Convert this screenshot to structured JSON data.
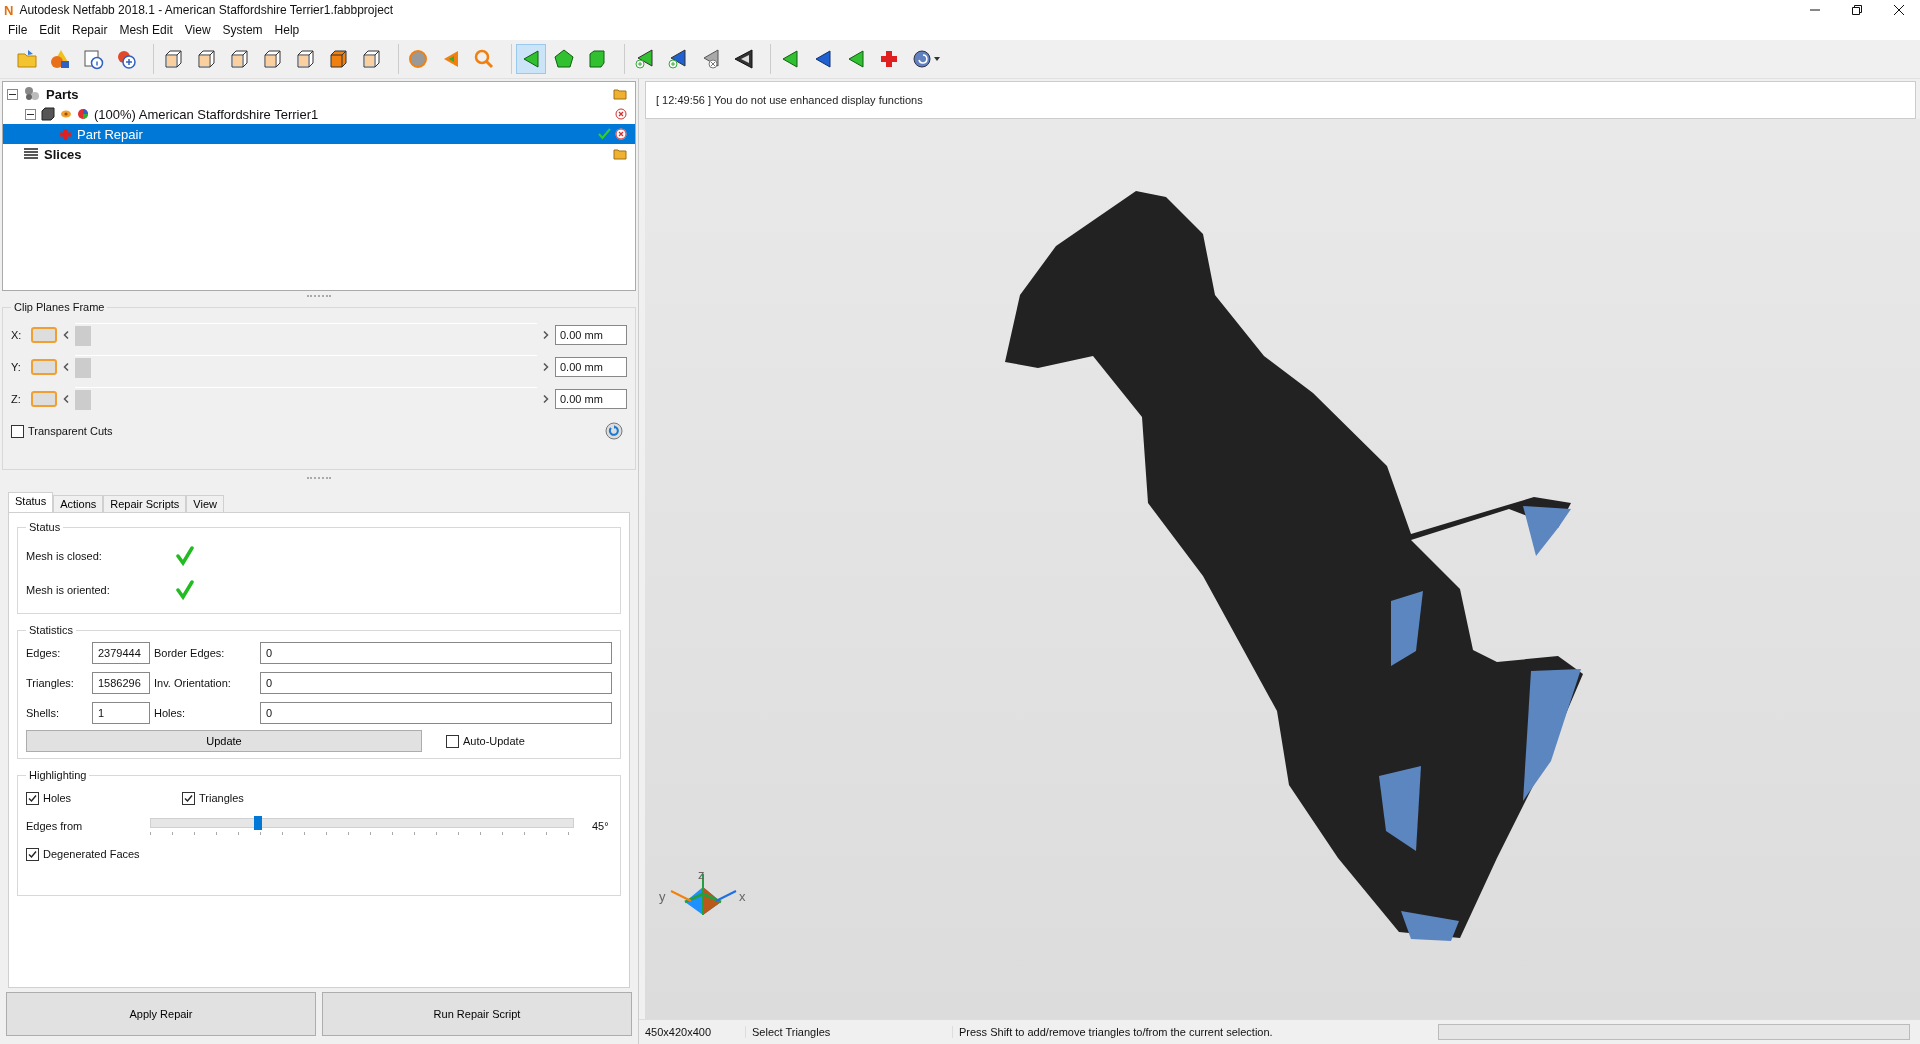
{
  "window": {
    "title": "Autodesk Netfabb 2018.1 - American Staffordshire Terrier1.fabbproject",
    "app_letter": "N"
  },
  "menu": [
    "File",
    "Edit",
    "Repair",
    "Mesh Edit",
    "View",
    "System",
    "Help"
  ],
  "toolbar_groups": [
    {
      "buttons": [
        {
          "kind": "folder",
          "selected": false
        },
        {
          "kind": "shapes",
          "selected": false
        },
        {
          "kind": "info",
          "selected": false
        },
        {
          "kind": "add",
          "selected": false
        }
      ]
    },
    {
      "buttons": [
        {
          "kind": "cube",
          "selected": false
        },
        {
          "kind": "cube",
          "selected": false
        },
        {
          "kind": "cube",
          "selected": false
        },
        {
          "kind": "cube",
          "selected": false
        },
        {
          "kind": "cube",
          "selected": false
        },
        {
          "kind": "cube-solid",
          "selected": false
        },
        {
          "kind": "cube",
          "selected": false
        }
      ]
    },
    {
      "buttons": [
        {
          "kind": "sphere",
          "selected": false
        },
        {
          "kind": "arrow",
          "selected": false
        },
        {
          "kind": "magnifier",
          "selected": false
        }
      ]
    },
    {
      "buttons": [
        {
          "kind": "triangle",
          "selected": true
        },
        {
          "kind": "pentagon",
          "selected": false
        },
        {
          "kind": "square",
          "selected": false
        }
      ]
    },
    {
      "buttons": [
        {
          "kind": "triangle-add",
          "selected": false
        },
        {
          "kind": "triangle-blue-add",
          "selected": false
        },
        {
          "kind": "triangle-remove",
          "selected": false
        },
        {
          "kind": "triangle-dark",
          "selected": false
        }
      ]
    },
    {
      "buttons": [
        {
          "kind": "triangle",
          "selected": false
        },
        {
          "kind": "triangle-blue",
          "selected": false
        },
        {
          "kind": "triangle",
          "selected": false
        },
        {
          "kind": "cross",
          "selected": false
        },
        {
          "kind": "globe",
          "selected": false
        }
      ]
    }
  ],
  "tree": [
    {
      "label": "Parts",
      "kind": "group",
      "selected": false,
      "expanded": true,
      "children": [
        {
          "label": "(100%) American Staffordshire Terrier1",
          "kind": "part",
          "selected": false,
          "expanded": true,
          "children": [
            {
              "label": "Part Repair",
              "kind": "repair",
              "selected": true
            }
          ]
        }
      ]
    },
    {
      "label": "Slices",
      "kind": "slices",
      "selected": false
    }
  ],
  "clip_planes": {
    "title": "Clip Planes Frame",
    "rows": [
      {
        "axis": "X:",
        "level": 0,
        "value": "0.00 mm"
      },
      {
        "axis": "Y:",
        "level": 0,
        "value": "0.00 mm"
      },
      {
        "axis": "Z:",
        "level": 0,
        "value": "0.00 mm"
      }
    ],
    "transparent_cuts": {
      "label": "Transparent Cuts",
      "checked": false
    }
  },
  "tabs": [
    {
      "label": "Status",
      "selected": true
    },
    {
      "label": "Actions",
      "selected": false
    },
    {
      "label": "Repair Scripts",
      "selected": false
    },
    {
      "label": "View",
      "selected": false
    }
  ],
  "status": {
    "title": "Status",
    "rows": [
      {
        "label": "Mesh is closed:",
        "ok": true
      },
      {
        "label": "Mesh is oriented:",
        "ok": true
      }
    ]
  },
  "statistics": {
    "title": "Statistics",
    "fields": [
      {
        "label": "Edges:",
        "value": "2379444",
        "label_2": "Border Edges:",
        "value_2": "0"
      },
      {
        "label": "Triangles:",
        "value": "1586296",
        "label_2": "Inv. Orientation:",
        "value_2": "0"
      },
      {
        "label": "Shells:",
        "value": "1",
        "label_2": "Holes:",
        "value_2": "0"
      }
    ],
    "update_button": "Update",
    "auto_update": {
      "label": "Auto-Update",
      "checked": false
    }
  },
  "highlighting": {
    "title": "Highlighting",
    "holes": {
      "label": "Holes",
      "checked": true
    },
    "triangles": {
      "label": "Triangles",
      "checked": true
    },
    "edges_from": {
      "label": "Edges from",
      "level": 0.25,
      "reading": "45°"
    },
    "degenerated_faces": {
      "label": "Degenerated Faces",
      "checked": true
    }
  },
  "buttons": [
    "Apply Repair",
    "Run Repair Script"
  ],
  "message": "[ 12:49:56 ] You do not use enhanced display functions",
  "axes": {
    "z": "z",
    "y": "y",
    "x": "x"
  },
  "status_bar": {
    "dimensions": "450x420x400",
    "mode": "Select Triangles",
    "hint": "Press Shift to add/remove triangles to/from the current selection.",
    "progress": {
      "level": 0
    }
  }
}
